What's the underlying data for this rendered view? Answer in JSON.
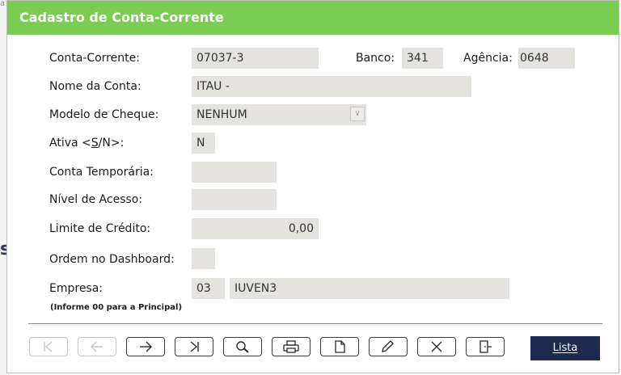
{
  "background": {
    "corner_mark": "a",
    "side_mark": "s"
  },
  "dialog": {
    "title": "Cadastro de Conta-Corrente"
  },
  "form": {
    "conta_corrente": {
      "label": "Conta-Corrente:",
      "value": "07037-3"
    },
    "banco": {
      "label": "Banco:",
      "value": "341"
    },
    "agencia": {
      "label": "Agência:",
      "value": "0648"
    },
    "nome_conta": {
      "label": "Nome da Conta:",
      "value": "ITAU -"
    },
    "modelo_cheque": {
      "label": "Modelo de Cheque:",
      "value": "NENHUM"
    },
    "ativa": {
      "label_prefix": "Ativa <",
      "label_accel": "S",
      "label_suffix": "/N>:",
      "value": "N"
    },
    "conta_temporaria": {
      "label": "Conta Temporária:",
      "value": ""
    },
    "nivel_acesso": {
      "label": "Nível de Acesso:",
      "value": ""
    },
    "limite_credito": {
      "label": "Limite de Crédito:",
      "value": "0,00"
    },
    "ordem_dashboard": {
      "label": "Ordem no Dashboard:",
      "value": ""
    },
    "empresa": {
      "label": "Empresa:",
      "code": "03",
      "name": "IUVEN3",
      "hint": "(Informe 00 para a Principal)"
    }
  },
  "toolbar": {
    "buttons": [
      {
        "icon": "first-icon",
        "enabled": false
      },
      {
        "icon": "previous-icon",
        "enabled": false
      },
      {
        "icon": "next-icon",
        "enabled": true
      },
      {
        "icon": "last-icon",
        "enabled": true
      },
      {
        "icon": "search-icon",
        "enabled": true
      },
      {
        "icon": "print-icon",
        "enabled": true
      },
      {
        "icon": "new-document-icon",
        "enabled": true
      },
      {
        "icon": "edit-icon",
        "enabled": true
      },
      {
        "icon": "delete-icon",
        "enabled": true
      },
      {
        "icon": "exit-icon",
        "enabled": true
      }
    ],
    "lista_label": "Lista"
  },
  "colors": {
    "titlebar": "#7acc52",
    "field_bg": "#e5e3e0",
    "lista_bg": "#1b2a4e"
  }
}
